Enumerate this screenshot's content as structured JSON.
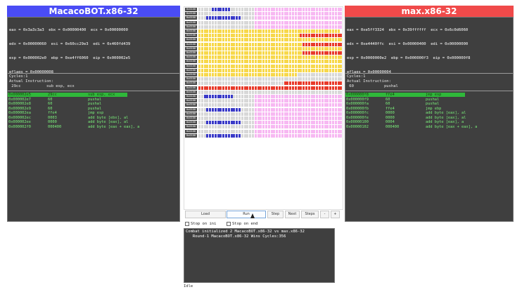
{
  "left": {
    "title": "MacacoBOT.x86-32",
    "title_bg": "#4a4cf5",
    "registers": [
      "eax = 0x3a3c3a3  ebx = 0x00000400  ecx = 0x00000000",
      "edx = 0x00000060  esi = 0x60cc29e3  edi = 0x460fd439",
      "esp = 0x000002e0  ebp = 0xe4ff6060  eip = 0x000002e5",
      "eflags = 0x00000008"
    ],
    "cycles": "Cycles:1",
    "actual_label": "Actual Instruction:",
    "actual": " 29cc           sub esp, ecx",
    "code": [
      {
        "addr": "0x000002e5",
        "bytes": "29cc",
        "ins": "sub esp, ecx",
        "hl": true
      },
      {
        "addr": "0x000002e7",
        "bytes": "60",
        "ins": "pushal",
        "hl": false
      },
      {
        "addr": "0x000002e8",
        "bytes": "60",
        "ins": "pushal",
        "hl": false
      },
      {
        "addr": "0x000002e9",
        "bytes": "60",
        "ins": "pushal",
        "hl": false
      },
      {
        "addr": "0x000002ea",
        "bytes": "ffe4",
        "ins": "jmp esp",
        "hl": false
      },
      {
        "addr": "0x000002ec",
        "bytes": "0003",
        "ins": "add byte [ebx], al",
        "hl": false
      },
      {
        "addr": "0x000002ee",
        "bytes": "0000",
        "ins": "add byte [eax], al",
        "hl": false
      },
      {
        "addr": "0x000002f0",
        "bytes": "000400",
        "ins": "add byte [eax + eax], a",
        "hl": false
      }
    ]
  },
  "right": {
    "title": "max.x86-32",
    "title_bg": "#f04a4a",
    "registers": [
      "eax = 0xe5ff3324  ebx = 0x39ffffff  ecx = 0x6c0d6060",
      "edx = 0xe4440ffc  esi = 0x00000400  edi = 0x00000000",
      "esp = 0x0000000e2  ebp = 0x000000f3  eip = 0x000000f8",
      "eflags = 0x00000004"
    ],
    "cycles": "Cycles:1",
    "actual_label": "Actual Instruction:",
    "actual": " 60             pushal",
    "code": [
      {
        "addr": "0x000000f8",
        "bytes": "ffe4",
        "ins": "jmp esp",
        "hl": true
      },
      {
        "addr": "0x000000f9",
        "bytes": "60",
        "ins": "pushal",
        "hl": false
      },
      {
        "addr": "0x000000fa",
        "bytes": "60",
        "ins": "pushal",
        "hl": false
      },
      {
        "addr": "0x000000fb",
        "bytes": "ffe4",
        "ins": "jmp ebp",
        "hl": false
      },
      {
        "addr": "0x000000fc",
        "bytes": "0000",
        "ins": "add byte [eax], al",
        "hl": false
      },
      {
        "addr": "0x000000fe",
        "bytes": "0000",
        "ins": "add byte [eax], al",
        "hl": false
      },
      {
        "addr": "0x00000100",
        "bytes": "0004",
        "ins": "add byte [eax], a",
        "hl": false
      },
      {
        "addr": "0x00000102",
        "bytes": "000400",
        "ins": "add byte [eax + eax], a",
        "hl": false
      }
    ]
  },
  "memory": {
    "row_label": "0x0100",
    "colors": {
      "empty": "#d8d8d8",
      "pink": "#f7b8f2",
      "yellow": "#f7d84a",
      "red": "#e83a2a",
      "blue": "#3a3ac8"
    },
    "rows": [
      "EEEEEBBBBBBBEEEEEEEEEPPPPPPPPPPPPPPPPPPPPPPPPPPPPPPPPP",
      "EEEEEEEEEEEEEEEEEEEEEPPPPPPPPPPPPPPPPPPPPPPPPPPPPPPPPP",
      "EEEBBBBBBBBBBBBBEEEEEPPPPPPPPPPPPPPPPPPPPPPPPPPPPPPPPP",
      "EEEEEEEEEEEEEEEEEEEEEPPPPPPPPPPPPPPPPPPPPPPPPPPPPPPPPP",
      "EEEEEEEEEEEEEEEEEEEEEPPPPPPPPPPPPPPPPPPPPPPPPPPPPPPPPP",
      "YYYYYYYYYYYYYYYYYYYYYYYYYYYYYYYYYYYYYYYYYYYYYYYYYYYYY",
      "YYYYYYYYYYYYYYYYYYYYYYYYYYYYYYYYYYYYYYRRRRRRRRRRRRRRRR",
      "YYYYYYYYYYYYYYYYYYYYYYYYYYYYYYYYYYYYYYYYYYYYYYYYYYYYYY",
      "YYYYYYYYYYYYYYYYYYYYYYYYYYYYYYYYYYYYYYYRRRRRRRRRRRRRRR",
      "YYYYYYYYYYYYYYYYYYYYYYYYYYYYYYYYYYYYYYYYYYYYYYYYYYYYYY",
      "YYYYYYYYYYYYYYYYYYYYYYYYYYYYYYYYYYYYYYYRRRRRRRRRRRRRRR",
      "YYYYYYYYYYYYYYYYYYYYYYYYYYYYYYYYYYYYYYYYYYYYYYYYYYYYYY",
      "YYYYYYYYYYYYYYYYYYYYYYYYYYYYYYYYYYYYYYYYYYYYYYYYYYYYYY",
      "YYYYYYYYYYYYYYYYYYYYYYYYYYYYYYYYYYYYYYYYYYYYYYYYYYYYYY",
      "YYYYYYYYYYYYYYYYYYYYYYYYYYYYYYYYYYYYYYYYYYYYYYYYYYYYYY",
      "YYYYYYYYYYYYYYYYYYYYYYYYYYYYYYYYYYYYYEEEEEEEEEEEEEEEEE",
      "EEEEEEEEEEEEEEEEEEEEEEEEEEEEEEEEEEEEEEEEEEEEEEEEEEEEEE",
      "EEEEEEEEEEEEEEEEEEEEEEEEEEEEEEEERRRRRRRRRRRRRRRRRRRRRR",
      "RRRRRRRRRRRRRRRRRRRRRRRRRRRRRRRRRRRRRRRRRRRRRRRRRRRRRR",
      "EEEEEEEEEEEEEEEEEEEEEEEEEEEEEEEEEEEEEEEEEEEEEEEEEEEEEE",
      "EEBBBBBBBBBBBEEEEEEEEPPPPPPPPPPPPPPPPPPPPPPPPPPPPPPPPP",
      "EEEEEEEEEEEEEEEEEEEEEPPPPPPPPPPPPPPPPPPPPPPPPPPPPPPPPP",
      "EEEEEEEEEEEEEEEEEEEEEPPPPPPPPPPPPPPPPPPPPPPPPPPPPPPPPP",
      "EEEBBBBBBBBBBBBBEEEEEPPPPPPPPPPPPPPPPPPPPPPPPPPPPPPPPP",
      "EEEEEEEEEEEEEEEEEEEEEPPPPPPPPPPPPPPPPPPPPPPPPPPPPPPPPP",
      "EEEEEEEEEEEEEEEEEEEEEPPPPPPPPPPPPPPPPPPPPPPPPPPPPPPPPP",
      "EEEBBBBBBBBBBBBBEEEEEPPPPPPPPPPPPPPPPPPPPPPPPPPPPPPPPP",
      "EEEEEEEEEEEEEEEEEEEEEPPPPPPPPPPPPPPPPPPPPPPPPPPPPPPPPP",
      "EEEEEEEEEEEEEEEEEEEEEPPPPPPPPPPPPPPPPPPPPPPPPPPPPPPPPP",
      "EEEBBBBBBBBBBBBBEEEEEPPPPPPPPPPPPPPPPPPPPPPPPPPPPPPPPP"
    ]
  },
  "controls": {
    "load": "Load",
    "run": "Run",
    "step": "Step",
    "next": "Next",
    "steps": "Steps",
    "minus": "-",
    "plus": "+",
    "stop_on_ini": "Stop on ini",
    "stop_on_end": "Stop on end"
  },
  "log": [
    "Combat initialized 2 MacacoBOT.x86-32 vs max.x86-32",
    "   Round-1 MacacoBOT.x86-32 Wins Cycles:356"
  ],
  "status": "Idle"
}
